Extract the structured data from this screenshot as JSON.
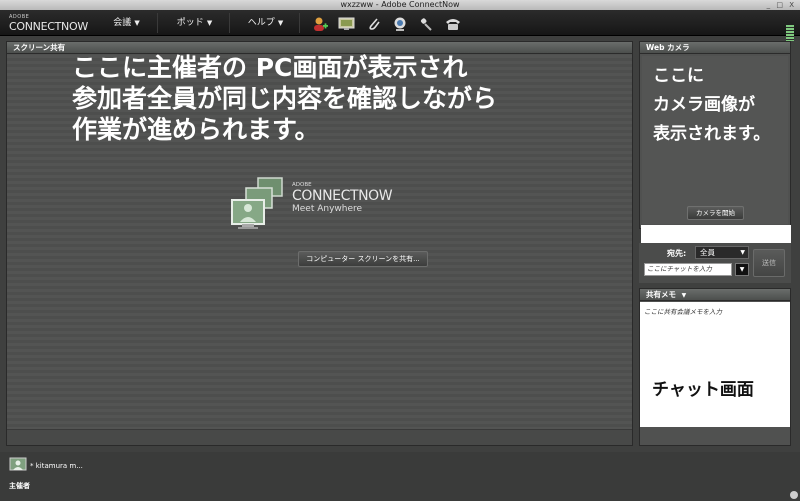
{
  "window": {
    "title": "wxzzww - Adobe ConnectNow",
    "controls": "_ □ X"
  },
  "logo": {
    "small": "ADOBE",
    "big": "CONNECTNOW"
  },
  "menu": {
    "meeting": "会議",
    "pod": "ポッド",
    "help": "ヘルプ"
  },
  "toolbar_icons": [
    "add-participant-icon",
    "share-screen-icon",
    "attachment-icon",
    "webcam-icon",
    "microphone-icon",
    "phone-icon"
  ],
  "screen_share": {
    "header": "スクリーン共有",
    "annotation_line1": "ここに主催者の PC画面が表示され",
    "annotation_line2": "参加者全員が同じ内容を確認しながら",
    "annotation_line3": "作業が進められます。",
    "logo_adobe": "ADOBE",
    "logo_name": "CONNECTNOW",
    "logo_tagline": "Meet Anywhere",
    "share_button": "コンピューター スクリーンを共有..."
  },
  "webcam": {
    "header": "Web カメラ",
    "annotation_line1": "ここに",
    "annotation_line2": "カメラ画像が",
    "annotation_line3": "表示されます。",
    "start_button": "カメラを開始"
  },
  "chat": {
    "to_label": "宛先:",
    "to_value": "全員",
    "input_placeholder": "ここにチャットを入力",
    "send_button": "送信"
  },
  "memo": {
    "header": "共有メモ",
    "placeholder": "ここに共有会議メモを入力",
    "annotation": "チャット画面"
  },
  "attendees": {
    "name": "* kitamura m...",
    "role": "主催者"
  },
  "colors": {
    "panel_header": "#5a5d5b",
    "background": "#3f403f",
    "menubar": "#1f1f1f"
  }
}
